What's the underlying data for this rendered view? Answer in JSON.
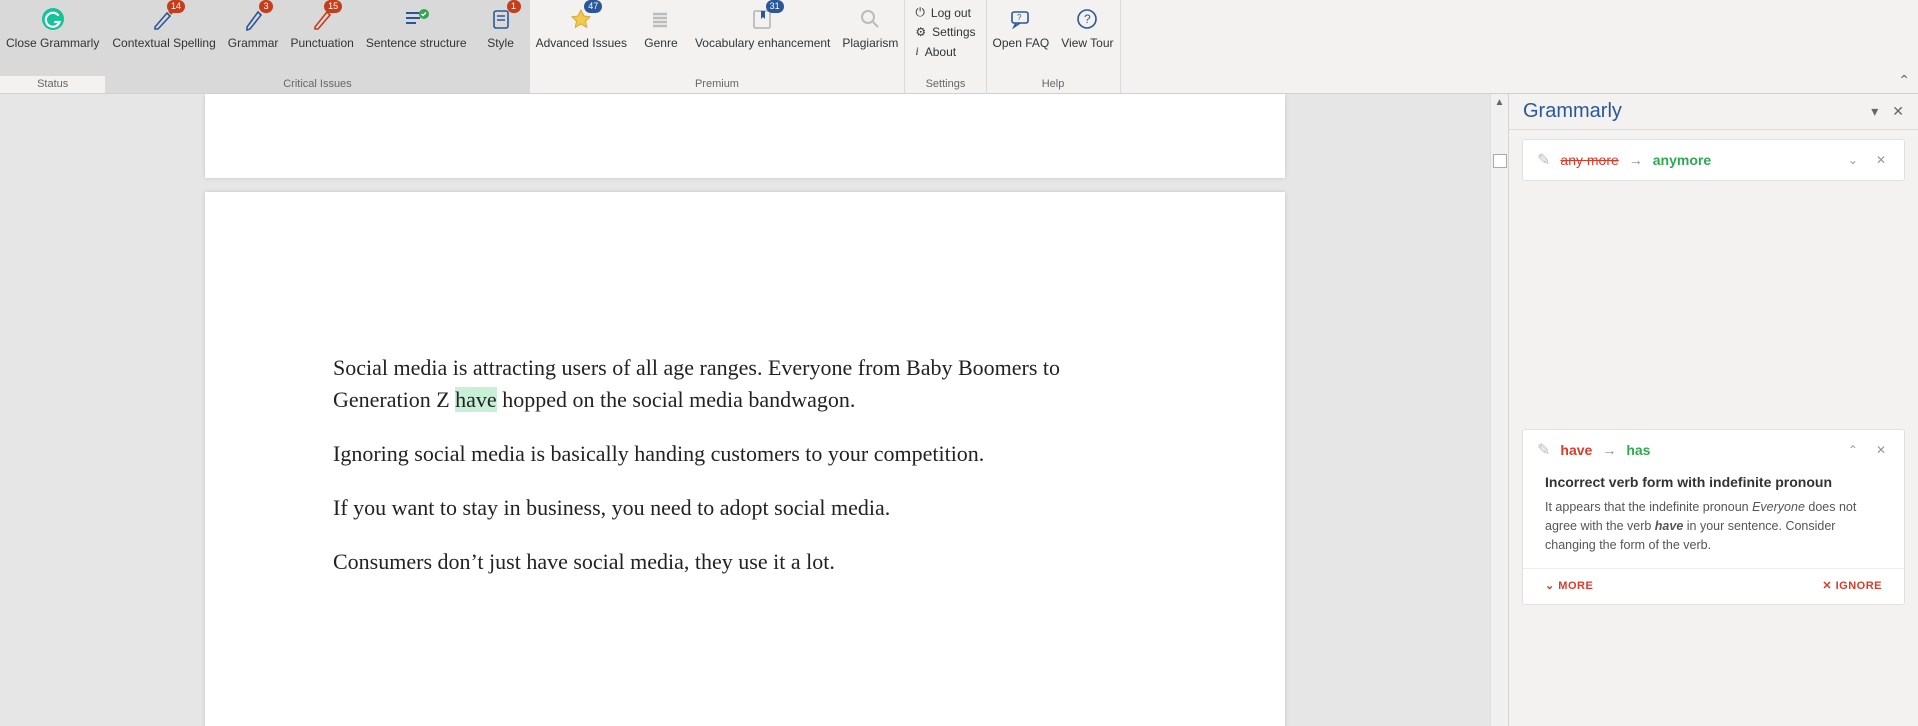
{
  "ribbon": {
    "groups": {
      "status": {
        "label": "Status",
        "close": "Close Grammarly"
      },
      "critical": {
        "label": "Critical Issues",
        "contextual": {
          "label": "Contextual Spelling",
          "badge": "14"
        },
        "grammar": {
          "label": "Grammar",
          "badge": "3"
        },
        "punctuation": {
          "label": "Punctuation",
          "badge": "15"
        },
        "sentence": {
          "label": "Sentence structure"
        },
        "style": {
          "label": "Style",
          "badge": "1"
        }
      },
      "premium": {
        "label": "Premium",
        "advanced": {
          "label": "Advanced Issues",
          "badge": "47"
        },
        "genre": {
          "label": "Genre"
        },
        "vocab": {
          "label": "Vocabulary enhancement",
          "badge": "31"
        },
        "plagiarism": {
          "label": "Plagiarism"
        }
      },
      "settings": {
        "label": "Settings",
        "logout": "Log out",
        "settings": "Settings",
        "about": "About"
      },
      "help": {
        "label": "Help",
        "openfaq": "Open FAQ",
        "viewtour": "View Tour"
      }
    }
  },
  "document": {
    "p1a": "Social media is attracting users of all age ranges. Everyone from Baby Boomers to Generation Z ",
    "p1hl": "have",
    "p1b": " hopped on the social media bandwagon.",
    "p2": "Ignoring social media is basically handing customers to your competition.",
    "p3": "If you want to stay in business,  you need to adopt social media.",
    "p4": "Consumers don’t just have social media, they use it a lot."
  },
  "panel": {
    "title": "Grammarly",
    "sugg1": {
      "from": "any more",
      "to": "anymore"
    },
    "sugg2": {
      "from": "have",
      "to": "has",
      "title": "Incorrect verb form with indefinite pronoun",
      "exp_a": "It appears that the indefinite pronoun ",
      "exp_em1": "Everyone",
      "exp_b": " does not agree with the verb ",
      "exp_em2": "have",
      "exp_c": " in your sentence. Consider changing the form of the verb.",
      "more": "MORE",
      "ignore": "IGNORE"
    }
  }
}
